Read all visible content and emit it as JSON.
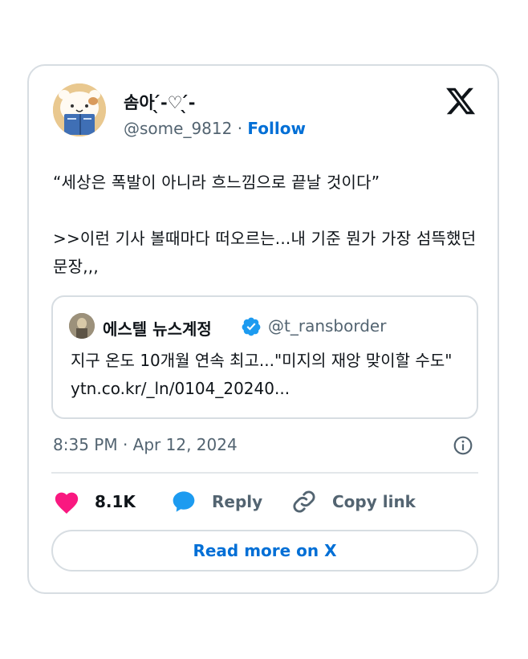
{
  "author": {
    "display_name": "솜아 ̖́-♡ ̖́-",
    "handle": "@some_9812",
    "separator": " · ",
    "follow_label": "Follow"
  },
  "tweet": {
    "text": "“세상은 폭발이 아니라 흐느낌으로 끝날 것이다”\n\n>>이런 기사 볼때마다 떠오르는...내 기준 뭔가 가장 섬뜩했던 문장,,,"
  },
  "quoted_tweet": {
    "display_name": "에스텔 뉴스계정",
    "handle": "@t_ransborder",
    "text": "지구 온도 10개월 연속 최고...\"미지의 재앙 맞이할 수도\" ytn.co.kr/_ln/0104_20240..."
  },
  "timestamp": "8:35 PM · Apr 12, 2024",
  "actions": {
    "like_count": "8.1K",
    "reply_label": "Reply",
    "copy_link_label": "Copy link"
  },
  "read_more_label": "Read more on X",
  "colors": {
    "accent": "#006fd6",
    "heart": "#f91880",
    "reply_bubble": "#1d9bf0",
    "muted_text": "#536471",
    "border": "#d7dde2"
  },
  "icons": [
    "x-logo-icon",
    "verified-badge-icon",
    "info-icon",
    "heart-icon",
    "reply-bubble-icon",
    "link-icon"
  ]
}
